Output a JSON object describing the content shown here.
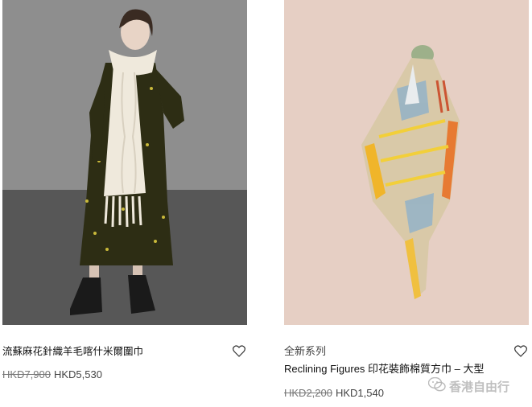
{
  "products": [
    {
      "id_label": "left",
      "tag": "",
      "title": "流蘇麻花針織羊毛喀什米爾圍巾",
      "old_price": "HKD7,900",
      "new_price": "HKD5,530",
      "image_desc_icon": "model-with-knit-scarf"
    },
    {
      "id_label": "right",
      "tag": "全新系列",
      "title": "Reclining Figures 印花裝飾棉質方巾 – 大型",
      "old_price": "HKD2,200",
      "new_price": "HKD1,540",
      "image_desc_icon": "printed-silk-square-scarf"
    }
  ],
  "watermark": {
    "text": "香港自由行",
    "icon": "wechat-icon"
  },
  "colors": {
    "left_bg_wall": "#8a8a8a",
    "left_bg_floor": "#5a5a5a",
    "right_bg": "#e6cfc4",
    "heart": "#333333"
  }
}
